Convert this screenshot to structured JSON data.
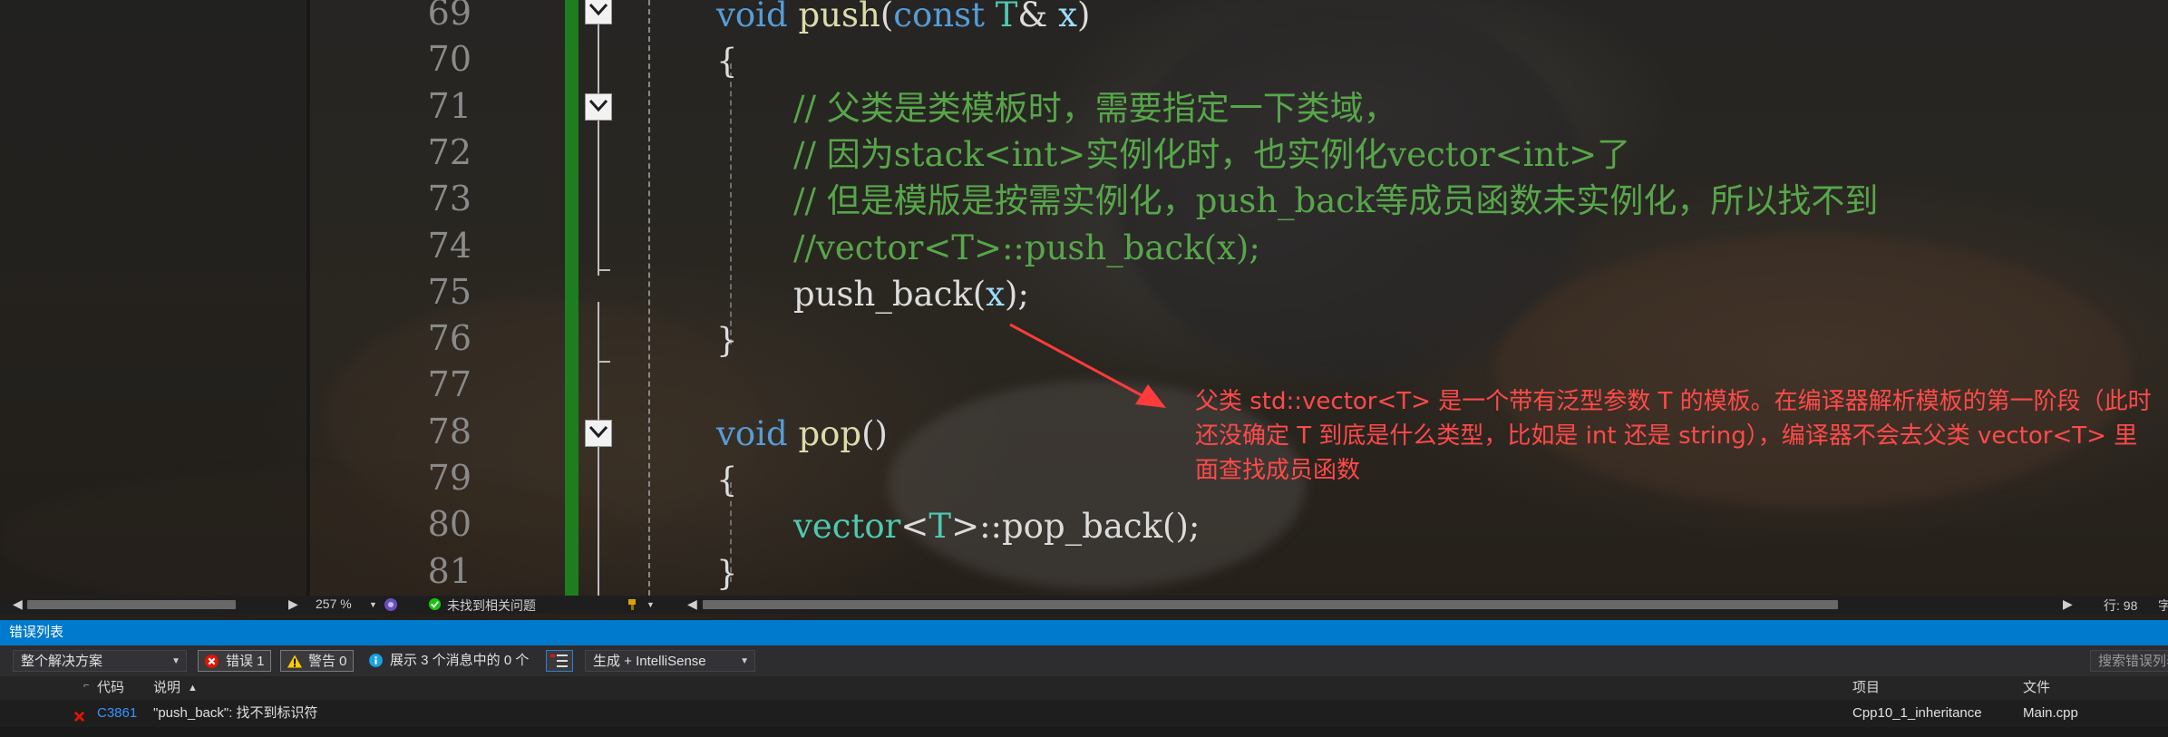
{
  "editor": {
    "lines": [
      {
        "num": "69",
        "tokens": [
          [
            "kw",
            "void "
          ],
          [
            "fn",
            "push"
          ],
          [
            "pl",
            "("
          ],
          [
            "kw",
            "const "
          ],
          [
            "ty",
            "T"
          ],
          [
            "pl",
            "& "
          ],
          [
            "pm",
            "x"
          ],
          [
            "pl",
            ")"
          ]
        ]
      },
      {
        "num": "70",
        "tokens": [
          [
            "pl",
            "{"
          ]
        ]
      },
      {
        "num": "71",
        "tokens": [
          [
            "cm",
            "// 父类是类模板时，需要指定一下类域，"
          ]
        ]
      },
      {
        "num": "72",
        "tokens": [
          [
            "cm",
            "// 因为stack<int>实例化时，也实例化vector<int>了"
          ]
        ]
      },
      {
        "num": "73",
        "tokens": [
          [
            "cm",
            "// 但是模版是按需实例化，push_back等成员函数未实例化，所以找不到"
          ]
        ]
      },
      {
        "num": "74",
        "tokens": [
          [
            "cm",
            "//vector<T>::push_back(x);"
          ]
        ]
      },
      {
        "num": "75",
        "tokens": [
          [
            "pl",
            "push_back("
          ],
          [
            "pm",
            "x"
          ],
          [
            "pl",
            ");"
          ]
        ]
      },
      {
        "num": "76",
        "tokens": [
          [
            "pl",
            "}"
          ]
        ]
      },
      {
        "num": "77",
        "tokens": []
      },
      {
        "num": "78",
        "tokens": [
          [
            "kw",
            "void "
          ],
          [
            "fn",
            "pop"
          ],
          [
            "pl",
            "()"
          ]
        ]
      },
      {
        "num": "79",
        "tokens": [
          [
            "pl",
            "{"
          ]
        ]
      },
      {
        "num": "80",
        "tokens": [
          [
            "ty",
            "vector"
          ],
          [
            "pl",
            "<"
          ],
          [
            "ty",
            "T"
          ],
          [
            "pl",
            ">::pop_back();"
          ]
        ]
      },
      {
        "num": "81",
        "tokens": [
          [
            "pl",
            "}"
          ]
        ]
      }
    ],
    "annotation": "父类 std::vector<T> 是一个带有泛型参数 T 的模板。在编译器解析模板的第一阶段（此时还没确定 T 到底是什么类型，比如是 int 还是 string），编译器不会去父类 vector<T> 里面查找成员函数",
    "annotation_color": "#ff4a4a",
    "change_bar_color": "#1e7d1e"
  },
  "status": {
    "zoom": "257 %",
    "issues": "未找到相关问题",
    "line_col": "行: 98",
    "trailing": "字"
  },
  "error_list": {
    "title": "错误列表",
    "scope": "整个解决方案",
    "errors_label": "错误 1",
    "warnings_label": "警告 0",
    "messages_label": "展示 3 个消息中的 0 个",
    "build_filter": "生成 + IntelliSense",
    "search_placeholder": "搜索错误列表",
    "columns": {
      "code": "代码",
      "description": "说明",
      "project": "项目",
      "file": "文件"
    },
    "rows": [
      {
        "code": "C3861",
        "description": "\"push_back\": 找不到标识符",
        "project": "Cpp10_1_inheritance",
        "file": "Main.cpp"
      }
    ]
  },
  "colors": {
    "accent": "#007acc",
    "error": "#e51400",
    "warning": "#ffcc00",
    "info": "#1ba1e2",
    "ok": "#16c60c"
  }
}
